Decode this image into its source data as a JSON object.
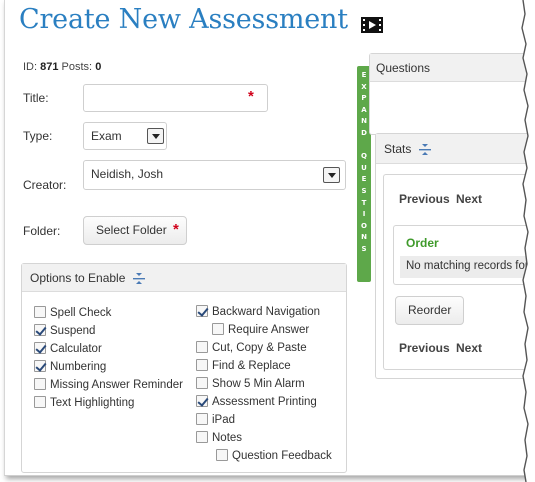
{
  "page": {
    "title": "Create New Assessment"
  },
  "meta": {
    "id_label": "ID:",
    "id_value": "871",
    "posts_label": "Posts:",
    "posts_value": "0"
  },
  "form": {
    "title_label": "Title:",
    "type_label": "Type:",
    "type_value": "Exam",
    "creator_label": "Creator:",
    "creator_value": "Neidish, Josh",
    "folder_label": "Folder:",
    "folder_button": "Select Folder",
    "required_mark": "*"
  },
  "options": {
    "title": "Options to Enable",
    "left": [
      {
        "label": "Spell Check",
        "checked": false
      },
      {
        "label": "Suspend",
        "checked": true
      },
      {
        "label": "Calculator",
        "checked": true
      },
      {
        "label": "Numbering",
        "checked": true
      },
      {
        "label": "Missing Answer Reminder",
        "checked": false
      },
      {
        "label": "Text Highlighting",
        "checked": false
      }
    ],
    "right": [
      {
        "label": "Backward Navigation",
        "checked": true
      },
      {
        "label": "Require Answer",
        "checked": false
      },
      {
        "label": "Cut, Copy & Paste",
        "checked": false
      },
      {
        "label": "Find & Replace",
        "checked": false
      },
      {
        "label": "Show 5 Min Alarm",
        "checked": false
      },
      {
        "label": "Assessment Printing",
        "checked": true
      },
      {
        "label": "iPad",
        "checked": false
      },
      {
        "label": "Notes",
        "checked": false
      },
      {
        "label": "Question Feedback",
        "checked": false
      }
    ]
  },
  "expand_questions": {
    "letters": [
      "E",
      "X",
      "P",
      "A",
      "N",
      "D",
      " ",
      "Q",
      "U",
      "E",
      "S",
      "T",
      "I",
      "O",
      "N",
      "S"
    ]
  },
  "questions_panel": {
    "title": "Questions"
  },
  "stats_panel": {
    "title": "Stats",
    "previous": "Previous",
    "next": "Next",
    "order_header": "Order",
    "empty_message": "No matching records found",
    "reorder_button": "Reorder"
  },
  "colors": {
    "title_blue": "#2a7fc1",
    "required_red": "#d0021b",
    "expand_green": "#5ea84a",
    "order_green": "#3f9a2b"
  }
}
